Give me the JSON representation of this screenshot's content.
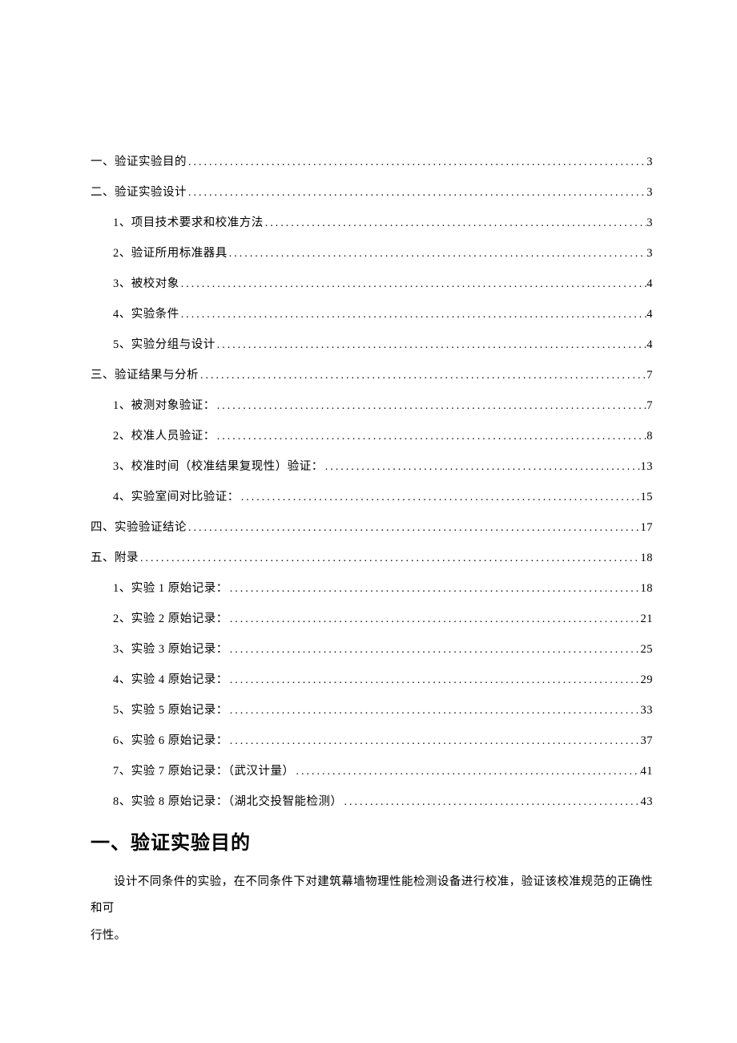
{
  "toc": [
    {
      "label": "一、验证实验目的",
      "page": "3",
      "level": 1
    },
    {
      "label": "二、验证实验设计",
      "page": "3",
      "level": 1
    },
    {
      "label": "1、项目技术要求和校准方法 ",
      "page": "3",
      "level": 2
    },
    {
      "label": "2、验证所用标准器具 ",
      "page": "3",
      "level": 2
    },
    {
      "label": "3、被校对象 ",
      "page": "4",
      "level": 2
    },
    {
      "label": "4、实验条件 ",
      "page": "4",
      "level": 2
    },
    {
      "label": "5、实验分组与设计 ",
      "page": "4",
      "level": 2
    },
    {
      "label": "三、验证结果与分析",
      "page": "7",
      "level": 1
    },
    {
      "label": "1、被测对象验证： ",
      "page": "7",
      "level": 2
    },
    {
      "label": "2、校准人员验证： ",
      "page": "8",
      "level": 2
    },
    {
      "label": "3、校准时间（校准结果复现性）验证： ",
      "page": "13",
      "level": 2
    },
    {
      "label": "4、实验室间对比验证： ",
      "page": "15",
      "level": 2
    },
    {
      "label": "四、实验验证结论",
      "page": "17",
      "level": 1
    },
    {
      "label": "五、附录",
      "page": "18",
      "level": 1
    },
    {
      "label": "1、实验 1 原始记录：",
      "page": "18",
      "level": 2
    },
    {
      "label": "2、实验 2 原始记录：",
      "page": "21",
      "level": 2
    },
    {
      "label": "3、实验 3 原始记录：",
      "page": "25",
      "level": 2
    },
    {
      "label": "4、实验 4 原始记录：",
      "page": "29",
      "level": 2
    },
    {
      "label": "5、实验 5 原始记录：",
      "page": "33",
      "level": 2
    },
    {
      "label": "6、实验 6 原始记录：",
      "page": "37",
      "level": 2
    },
    {
      "label": "7、实验 7 原始记录：（武汉计量）",
      "page": "41",
      "level": 2
    },
    {
      "label": "8、实验 8 原始记录：（湖北交投智能检测）",
      "page": "43",
      "level": 2
    }
  ],
  "section": {
    "heading": "一、验证实验目的",
    "para1": "设计不同条件的实验，在不同条件下对建筑幕墙物理性能检测设备进行校准，验证该校准规范的正确性和可",
    "para2": "行性。"
  },
  "dots": "......................................................................................................................................."
}
